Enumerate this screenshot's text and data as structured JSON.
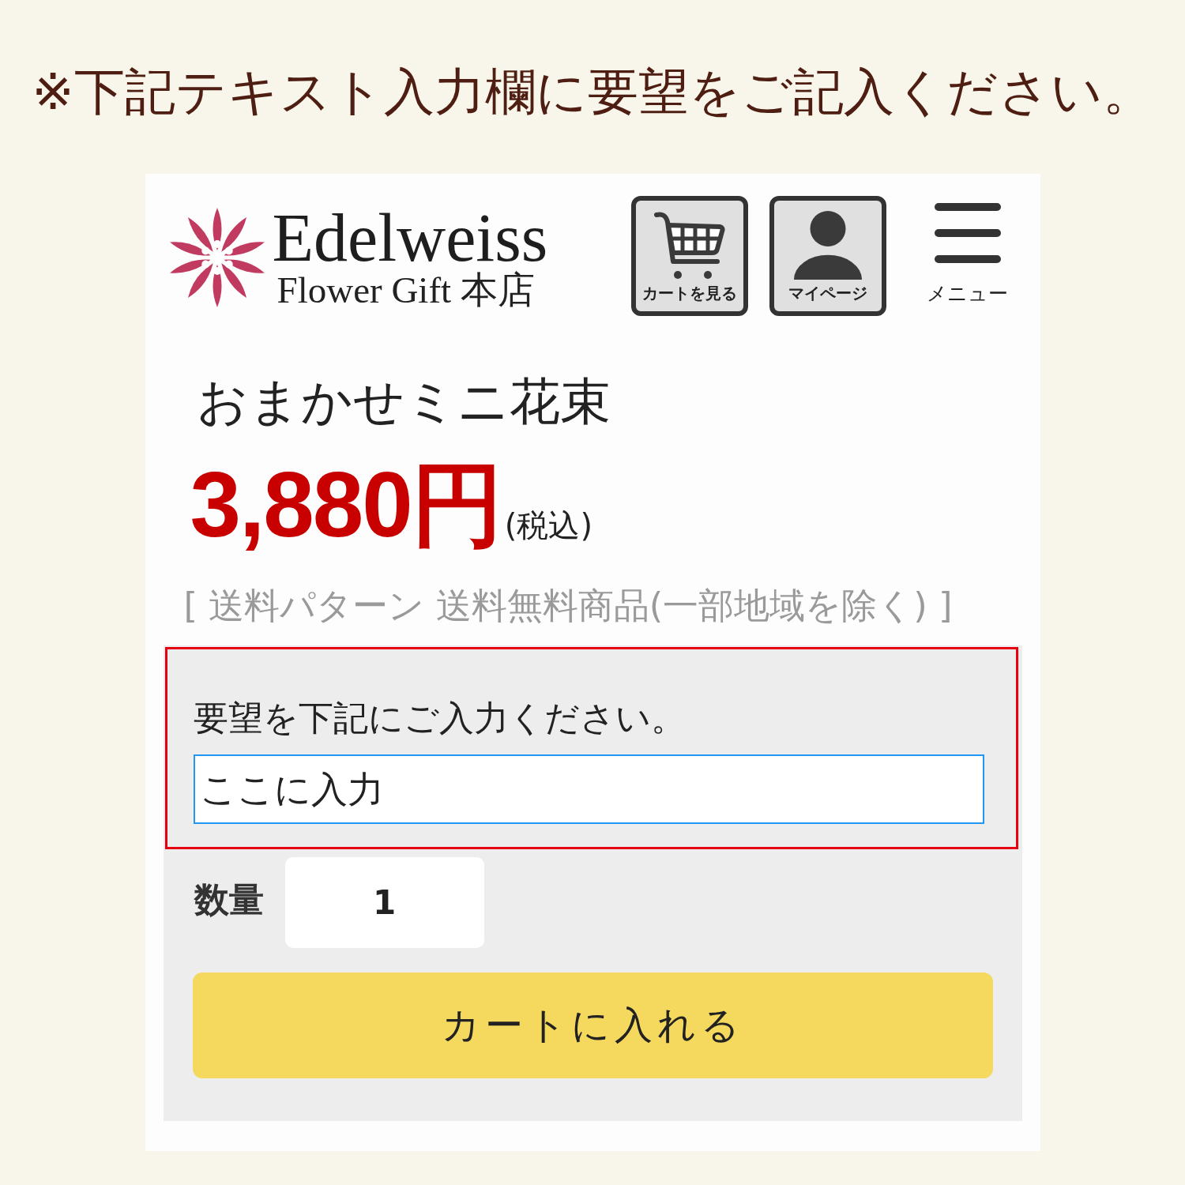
{
  "instruction": "※下記テキスト入力欄に要望をご記入ください。",
  "header": {
    "logo": {
      "title": "Edelweiss",
      "subtitle": "Flower Gift 本店"
    },
    "buttons": [
      {
        "kind": "cart",
        "label": "カートを見る"
      },
      {
        "kind": "account",
        "label": "マイページ"
      },
      {
        "kind": "menu",
        "label": "メニュー"
      }
    ]
  },
  "product": {
    "name": "おまかせミニ花束",
    "price": "3,880円",
    "tax_note": "(税込)",
    "shipping": "[ 送料パターン 送料無料商品(一部地域を除く) ]"
  },
  "order_form": {
    "highlighted": true,
    "request": {
      "label": "要望を下記にご入力ください。",
      "value": "ここに入力"
    },
    "quantity": {
      "label": "数量",
      "value": "1"
    },
    "add_to_cart": "カートに入れる"
  }
}
